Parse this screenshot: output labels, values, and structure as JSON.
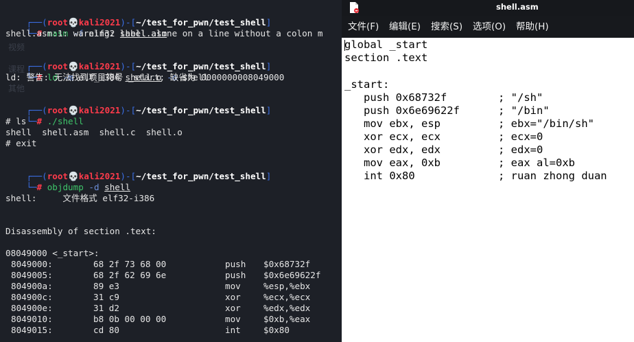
{
  "terminal": {
    "prompt": {
      "open": "┌──(",
      "user": "root",
      "skull": "💀",
      "host": "kali2021",
      "mid": ")-[",
      "path": "~/test_for_pwn/test_shell",
      "close": "]",
      "corner": "└─",
      "hash": "#"
    },
    "cmd1": {
      "name": "nasm",
      "opt": "-f",
      "arg": "elf32",
      "file": "shell.asm"
    },
    "out1": "shell.asm:1: warning: label alone on a line without a colon m",
    "cmd2": {
      "name": "ld",
      "opt1": "-m",
      "arg1": "elf_i386",
      "file": "shell.o",
      "opt2": "-o",
      "arg2": "shell"
    },
    "out2": "ld: 警告: 无法找到项目符号 _start; 缺省为 0000000008049000",
    "cmd3": {
      "name": "./shell"
    },
    "sub_lines": [
      "# ls",
      "shell  shell.asm  shell.c  shell.o",
      "# exit"
    ],
    "cmd4": {
      "name": "objdump",
      "opt": "-d",
      "file": "shell"
    },
    "objdump_header": "shell:     文件格式 elf32-i386",
    "section_line": "Disassembly of section .text:",
    "label_line": "08049000 <_start>:",
    "disasm": [
      {
        "addr": "8049000:",
        "bytes": "68 2f 73 68 00",
        "mnemonic": "push",
        "operand": "$0x68732f"
      },
      {
        "addr": "8049005:",
        "bytes": "68 2f 62 69 6e",
        "mnemonic": "push",
        "operand": "$0x6e69622f"
      },
      {
        "addr": "804900a:",
        "bytes": "89 e3",
        "mnemonic": "mov",
        "operand": "%esp,%ebx"
      },
      {
        "addr": "804900c:",
        "bytes": "31 c9",
        "mnemonic": "xor",
        "operand": "%ecx,%ecx"
      },
      {
        "addr": "804900e:",
        "bytes": "31 d2",
        "mnemonic": "xor",
        "operand": "%edx,%edx"
      },
      {
        "addr": "8049010:",
        "bytes": "b8 0b 00 00 00",
        "mnemonic": "mov",
        "operand": "$0xb,%eax"
      },
      {
        "addr": "8049015:",
        "bytes": "cd 80",
        "mnemonic": "int",
        "operand": "$0x80"
      }
    ],
    "ghost_labels": [
      "视频",
      "课程",
      "其他"
    ]
  },
  "editor": {
    "title": "shell.asm",
    "menu": [
      "文件(F)",
      "编辑(E)",
      "搜索(S)",
      "选项(O)",
      "帮助(H)"
    ],
    "code": [
      {
        "text": "global _start"
      },
      {
        "text": "section .text"
      },
      {
        "text": ""
      },
      {
        "text": "_start:"
      },
      {
        "instr": "   push 0x68732f",
        "comment": "; \"/sh\""
      },
      {
        "instr": "   push 0x6e69622f",
        "comment": "; \"/bin\""
      },
      {
        "instr": "   mov ebx, esp",
        "comment": "; ebx=\"/bin/sh\""
      },
      {
        "instr": "   xor ecx, ecx",
        "comment": "; ecx=0"
      },
      {
        "instr": "   xor edx, edx",
        "comment": "; edx=0"
      },
      {
        "instr": "   mov eax, 0xb",
        "comment": "; eax al=0xb"
      },
      {
        "instr": "   int 0x80",
        "comment": "; ruan zhong duan"
      }
    ]
  },
  "colors": {
    "terminal_bg": "#1d2027",
    "prompt_bracket": "#3b6fe6",
    "prompt_user": "#ff3b4b",
    "command": "#3fc56a",
    "option": "#6c8ed8",
    "editor_bg": "#ffffff",
    "editor_bar": "#17191d"
  }
}
